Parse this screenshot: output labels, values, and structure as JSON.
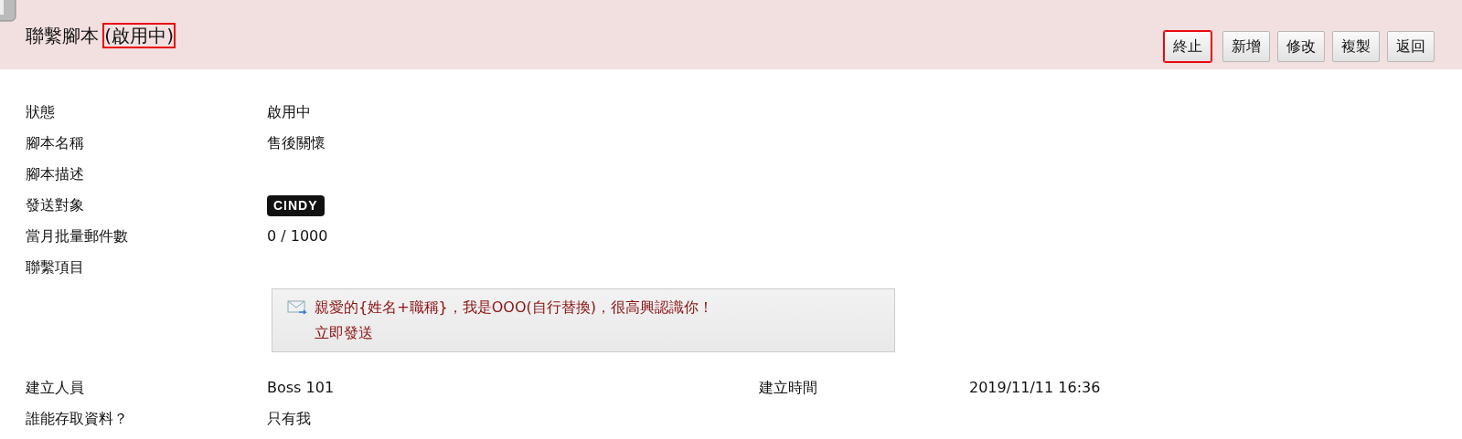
{
  "header": {
    "title": "聯繫腳本",
    "status": "(啟用中)",
    "status_highlighted": true
  },
  "buttons": [
    {
      "label": "終止",
      "highlighted": true
    },
    {
      "label": "新增",
      "highlighted": false
    },
    {
      "label": "修改",
      "highlighted": false
    },
    {
      "label": "複製",
      "highlighted": false
    },
    {
      "label": "返回",
      "highlighted": false
    }
  ],
  "fields": [
    {
      "label": "狀態",
      "kind": "text",
      "value": "啟用中"
    },
    {
      "label": "腳本名稱",
      "kind": "text",
      "value": "售後關懷"
    },
    {
      "label": "腳本描述",
      "kind": "text"
    },
    {
      "label": "發送對象",
      "kind": "tag",
      "value": "CINDY"
    },
    {
      "label": "當月批量郵件數",
      "kind": "text",
      "value": "0 / 1000"
    },
    {
      "label": "聯繫項目",
      "kind": "contact",
      "value": "親愛的{姓名+職稱}，我是OOO(自行替換)，很高興認識你！",
      "action": "立即發送"
    }
  ],
  "footer": [
    {
      "label": "建立人員",
      "value": "Boss 101",
      "label_2": "建立時間",
      "value_2": "2019/11/11 16:36"
    },
    {
      "label": "誰能存取資料？",
      "value": "只有我"
    }
  ]
}
